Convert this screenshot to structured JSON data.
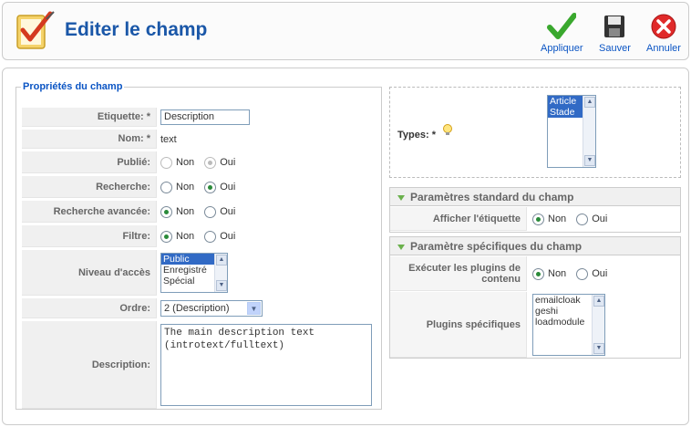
{
  "header": {
    "title": "Editer le champ",
    "buttons": [
      {
        "label": "Appliquer",
        "icon": "check-icon"
      },
      {
        "label": "Sauver",
        "icon": "floppy-disk-icon"
      },
      {
        "label": "Annuler",
        "icon": "cancel-icon"
      }
    ]
  },
  "props": {
    "legend": "Propriétés du champ",
    "etiquette": {
      "label": "Etiquette:",
      "req": "*",
      "value": "Description"
    },
    "nom": {
      "label": "Nom:",
      "req": "*",
      "value": "text"
    },
    "publie": {
      "label": "Publié:",
      "non": "Non",
      "oui": "Oui",
      "selected": "Oui"
    },
    "recherche": {
      "label": "Recherche:",
      "non": "Non",
      "oui": "Oui",
      "selected": "Oui"
    },
    "recherche_avancee": {
      "label": "Recherche avancée:",
      "non": "Non",
      "oui": "Oui",
      "selected": "Non"
    },
    "filtre": {
      "label": "Filtre:",
      "non": "Non",
      "oui": "Oui",
      "selected": "Non"
    },
    "niveau": {
      "label": "Niveau d'accès",
      "options": [
        "Public",
        "Enregistré",
        "Spécial"
      ],
      "selected": "Public"
    },
    "ordre": {
      "label": "Ordre:",
      "value": "2 (Description)"
    },
    "description": {
      "label": "Description:",
      "value": "The main description text\n(introtext/fulltext)"
    }
  },
  "types": {
    "label": "Types:",
    "req": "*",
    "options": [
      "Article",
      "Stade"
    ],
    "selected": [
      "Article",
      "Stade"
    ]
  },
  "standard": {
    "title": "Paramètres standard du champ",
    "afficher": {
      "label": "Afficher l'étiquette",
      "non": "Non",
      "oui": "Oui",
      "selected": "Non"
    }
  },
  "specifiques": {
    "title": "Paramètre spécifiques du champ",
    "executer": {
      "label": "Exécuter les plugins de contenu",
      "non": "Non",
      "oui": "Oui",
      "selected": "Non"
    },
    "plugins": {
      "label": "Plugins spécifiques",
      "options": [
        "emailcloak",
        "geshi",
        "loadmodule"
      ]
    }
  },
  "colors": {
    "title": "#1a57a8",
    "legend": "#0b55c4",
    "selection": "#316ac5",
    "radio_on": "#2a8a3a"
  }
}
